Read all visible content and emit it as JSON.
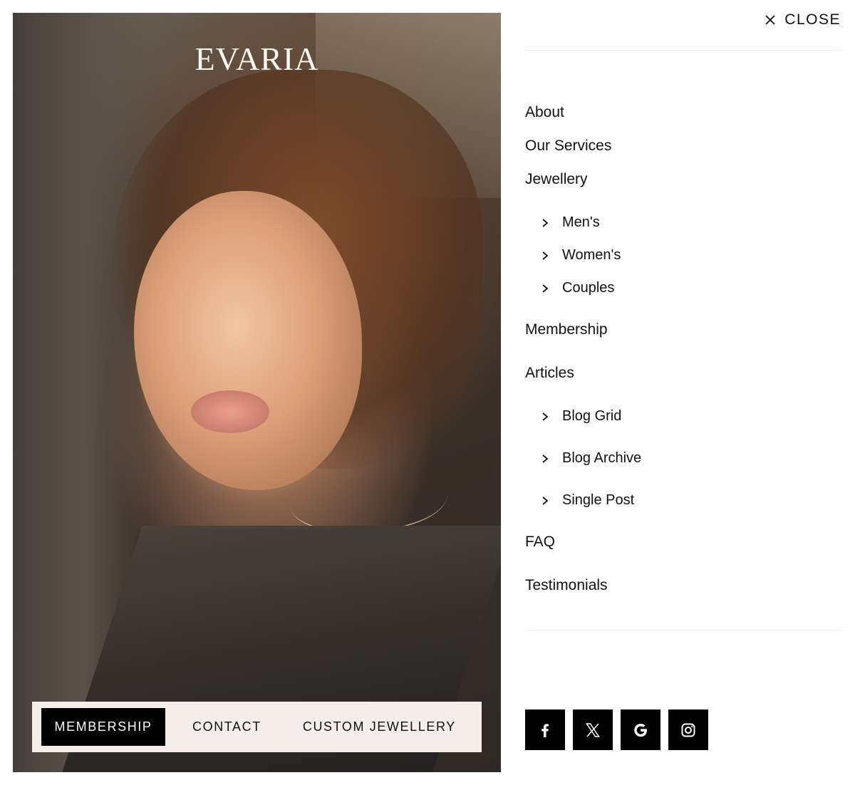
{
  "hero": {
    "brand": "EVARIA",
    "cta": [
      {
        "label": "MEMBERSHIP"
      },
      {
        "label": "CONTACT"
      },
      {
        "label": "CUSTOM JEWELLERY"
      }
    ]
  },
  "header": {
    "close_label": "CLOSE",
    "close_icon": "close-icon"
  },
  "nav": {
    "items": [
      {
        "label": "About"
      },
      {
        "label": "Our Services"
      },
      {
        "label": "Jewellery",
        "children": [
          {
            "label": "Men's"
          },
          {
            "label": "Women's"
          },
          {
            "label": "Couples"
          }
        ]
      },
      {
        "label": "Membership"
      },
      {
        "label": "Articles",
        "children": [
          {
            "label": "Blog Grid"
          },
          {
            "label": "Blog Archive"
          },
          {
            "label": "Single Post"
          }
        ]
      },
      {
        "label": "FAQ"
      },
      {
        "label": "Testimonials"
      }
    ]
  },
  "socials": [
    {
      "icon": "facebook-icon"
    },
    {
      "icon": "x-icon"
    },
    {
      "icon": "google-icon"
    },
    {
      "icon": "instagram-icon"
    }
  ],
  "colors": {
    "accent": "#000000",
    "bar_background": "#f5ede8",
    "text": "#111111"
  }
}
